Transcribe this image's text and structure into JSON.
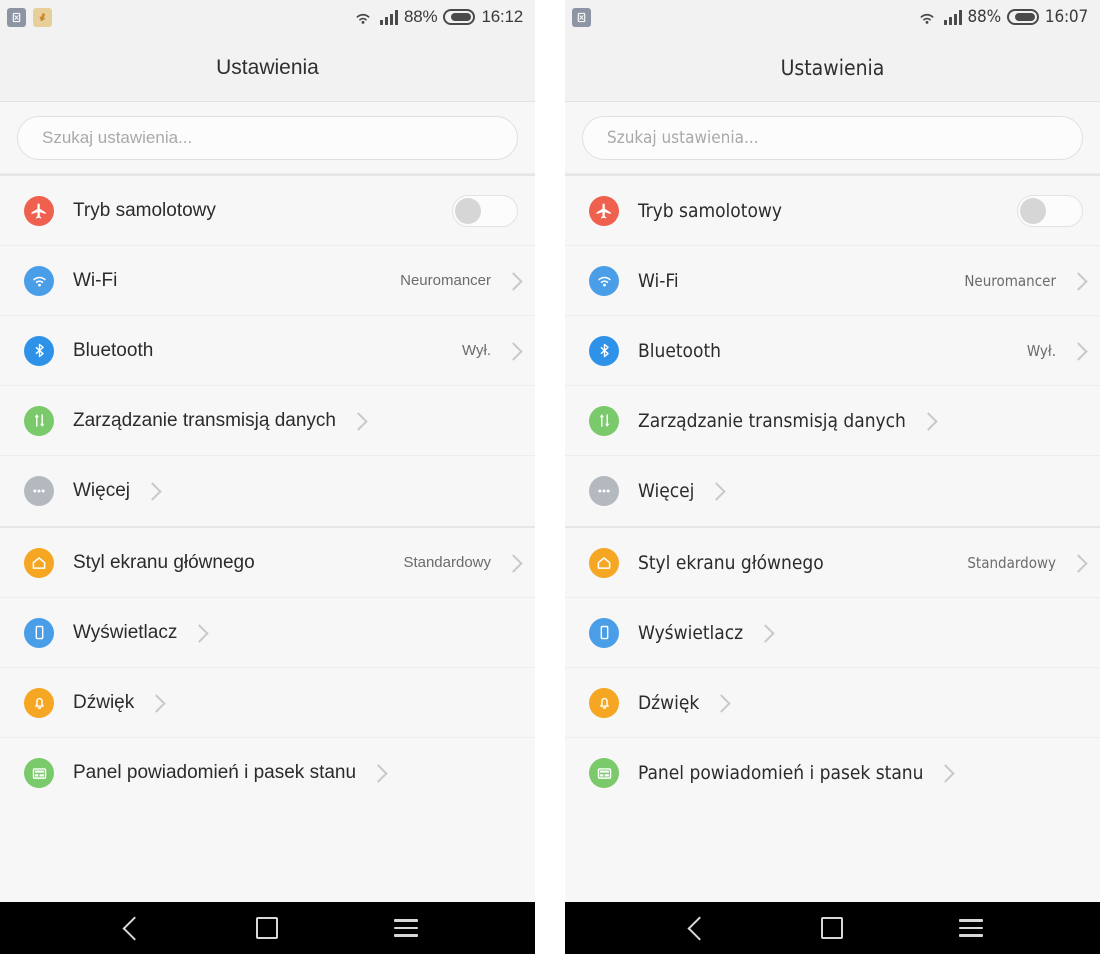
{
  "panels": [
    {
      "id": "left",
      "statusbar": {
        "notification_icons": [
          "document-notification-icon",
          "download-notification-icon"
        ],
        "wifi_icon": "wifi-icon",
        "signal_icon": "signal-bars-icon",
        "battery_percent": "88%",
        "battery_icon": "battery-icon",
        "time": "16:12"
      },
      "title": "Ustawienia",
      "search": {
        "placeholder": "Szukaj ustawienia..."
      },
      "groups": [
        {
          "rows": [
            {
              "icon": "airplane-icon",
              "color": "#f0604f",
              "label": "Tryb samolotowy",
              "value": "",
              "control": "toggle",
              "toggle_on": false
            },
            {
              "icon": "wifi-icon",
              "color": "#4a9ee8",
              "label": "Wi-Fi",
              "value": "Neuromancer",
              "control": "chevron"
            },
            {
              "icon": "bluetooth-icon",
              "color": "#2e93e8",
              "label": "Bluetooth",
              "value": "Wył.",
              "control": "chevron"
            },
            {
              "icon": "data-transfer-icon",
              "color": "#7ac96b",
              "label": "Zarządzanie transmisją danych",
              "value": "",
              "control": "chevron"
            },
            {
              "icon": "more-dots-icon",
              "color": "#b4b9bf",
              "label": "Więcej",
              "value": "",
              "control": "chevron"
            }
          ]
        },
        {
          "rows": [
            {
              "icon": "home-icon",
              "color": "#f5a623",
              "label": "Styl ekranu głównego",
              "value": "Standardowy",
              "control": "chevron"
            },
            {
              "icon": "display-icon",
              "color": "#4a9ee8",
              "label": "Wyświetlacz",
              "value": "",
              "control": "chevron"
            },
            {
              "icon": "bell-icon",
              "color": "#f5a623",
              "label": "Dźwięk",
              "value": "",
              "control": "chevron"
            },
            {
              "icon": "notification-panel-icon",
              "color": "#7ac96b",
              "label": "Panel powiadomień i pasek stanu",
              "value": "",
              "control": "chevron"
            }
          ]
        }
      ],
      "navbar": {
        "back": "back-icon",
        "home": "home-square-icon",
        "menu": "menu-icon"
      }
    },
    {
      "id": "right",
      "statusbar": {
        "notification_icons": [
          "document-notification-icon"
        ],
        "wifi_icon": "wifi-icon",
        "signal_icon": "signal-bars-icon",
        "battery_percent": "88%",
        "battery_icon": "battery-icon",
        "time": "16:07"
      },
      "title": "Ustawienia",
      "search": {
        "placeholder": "Szukaj ustawienia..."
      },
      "groups": [
        {
          "rows": [
            {
              "icon": "airplane-icon",
              "color": "#f0604f",
              "label": "Tryb samolotowy",
              "value": "",
              "control": "toggle",
              "toggle_on": false
            },
            {
              "icon": "wifi-icon",
              "color": "#4a9ee8",
              "label": "Wi-Fi",
              "value": "Neuromancer",
              "control": "chevron"
            },
            {
              "icon": "bluetooth-icon",
              "color": "#2e93e8",
              "label": "Bluetooth",
              "value": "Wył.",
              "control": "chevron"
            },
            {
              "icon": "data-transfer-icon",
              "color": "#7ac96b",
              "label": "Zarządzanie transmisją danych",
              "value": "",
              "control": "chevron"
            },
            {
              "icon": "more-dots-icon",
              "color": "#b4b9bf",
              "label": "Więcej",
              "value": "",
              "control": "chevron"
            }
          ]
        },
        {
          "rows": [
            {
              "icon": "home-icon",
              "color": "#f5a623",
              "label": "Styl ekranu głównego",
              "value": "Standardowy",
              "control": "chevron"
            },
            {
              "icon": "display-icon",
              "color": "#4a9ee8",
              "label": "Wyświetlacz",
              "value": "",
              "control": "chevron"
            },
            {
              "icon": "bell-icon",
              "color": "#f5a623",
              "label": "Dźwięk",
              "value": "",
              "control": "chevron"
            },
            {
              "icon": "notification-panel-icon",
              "color": "#7ac96b",
              "label": "Panel powiadomień i pasek stanu",
              "value": "",
              "control": "chevron"
            }
          ]
        }
      ],
      "navbar": {
        "back": "back-icon",
        "home": "home-square-icon",
        "menu": "menu-icon"
      }
    }
  ]
}
